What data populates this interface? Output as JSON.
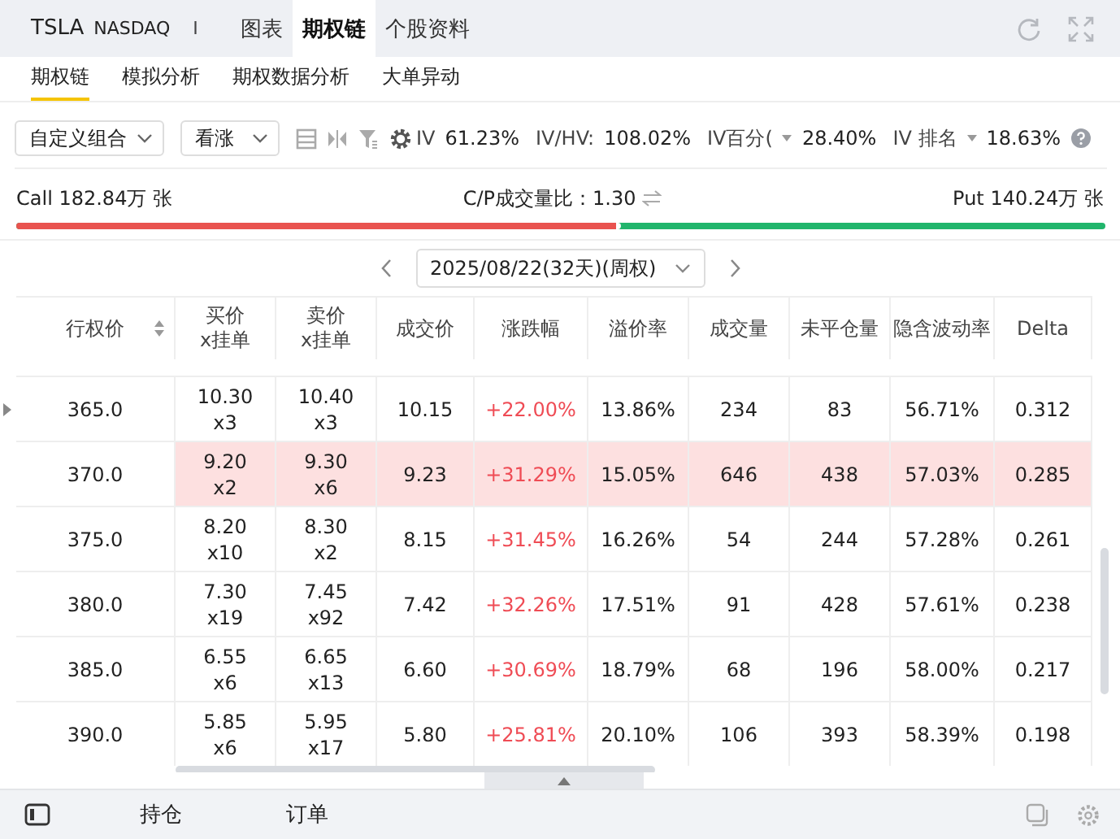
{
  "header": {
    "symbol": "TSLA",
    "exchange": "NASDAQ",
    "separator": "I",
    "tabs": [
      {
        "label": "图表",
        "selected": false
      },
      {
        "label": "期权链",
        "selected": true
      },
      {
        "label": "个股资料",
        "selected": false
      }
    ]
  },
  "subtabs": [
    {
      "label": "期权链",
      "selected": true
    },
    {
      "label": "模拟分析",
      "selected": false
    },
    {
      "label": "期权数据分析",
      "selected": false
    },
    {
      "label": "大单异动",
      "selected": false
    }
  ],
  "toolbar": {
    "combo": "自定义组合",
    "direction": "看涨",
    "iv_label": "IV",
    "iv": "61.23%",
    "ivhv_label": "IV/HV:",
    "ivhv": "108.02%",
    "ivpct_label": "IV百分(",
    "ivpct": "28.40%",
    "ivrank_label": "IV 排名",
    "ivrank": "18.63%"
  },
  "volume": {
    "call": "Call 182.84万 张",
    "ratio": "C/P成交量比：1.30",
    "put": "Put 140.24万 张",
    "level": 0.555
  },
  "expiry": "2025/08/22(32天)(周权)",
  "table": {
    "columns": [
      "行权价",
      "买价\nx挂单",
      "卖价\nx挂单",
      "成交价",
      "涨跌幅",
      "溢价率",
      "成交量",
      "未平仓量",
      "隐含波动率",
      "Delta"
    ],
    "rows": [
      {
        "strike": "365.0",
        "bid": "10.30",
        "bid_size": "x3",
        "ask": "10.40",
        "ask_size": "x3",
        "last": "10.15",
        "change": "+22.00%",
        "premium": "13.86%",
        "volume": "234",
        "oi": "83",
        "iv": "56.71%",
        "delta": "0.312",
        "selected": false
      },
      {
        "strike": "370.0",
        "bid": "9.20",
        "bid_size": "x2",
        "ask": "9.30",
        "ask_size": "x6",
        "last": "9.23",
        "change": "+31.29%",
        "premium": "15.05%",
        "volume": "646",
        "oi": "438",
        "iv": "57.03%",
        "delta": "0.285",
        "selected": true
      },
      {
        "strike": "375.0",
        "bid": "8.20",
        "bid_size": "x10",
        "ask": "8.30",
        "ask_size": "x2",
        "last": "8.15",
        "change": "+31.45%",
        "premium": "16.26%",
        "volume": "54",
        "oi": "244",
        "iv": "57.28%",
        "delta": "0.261",
        "selected": false
      },
      {
        "strike": "380.0",
        "bid": "7.30",
        "bid_size": "x19",
        "ask": "7.45",
        "ask_size": "x92",
        "last": "7.42",
        "change": "+32.26%",
        "premium": "17.51%",
        "volume": "91",
        "oi": "428",
        "iv": "57.61%",
        "delta": "0.238",
        "selected": false
      },
      {
        "strike": "385.0",
        "bid": "6.55",
        "bid_size": "x6",
        "ask": "6.65",
        "ask_size": "x13",
        "last": "6.60",
        "change": "+30.69%",
        "premium": "18.79%",
        "volume": "68",
        "oi": "196",
        "iv": "58.00%",
        "delta": "0.217",
        "selected": false
      },
      {
        "strike": "390.0",
        "bid": "5.85",
        "bid_size": "x6",
        "ask": "5.95",
        "ask_size": "x17",
        "last": "5.80",
        "change": "+25.81%",
        "premium": "20.10%",
        "volume": "106",
        "oi": "393",
        "iv": "58.39%",
        "delta": "0.198",
        "selected": false
      }
    ]
  },
  "bottom_tabs": [
    {
      "label": "持仓"
    },
    {
      "label": "订单"
    }
  ]
}
